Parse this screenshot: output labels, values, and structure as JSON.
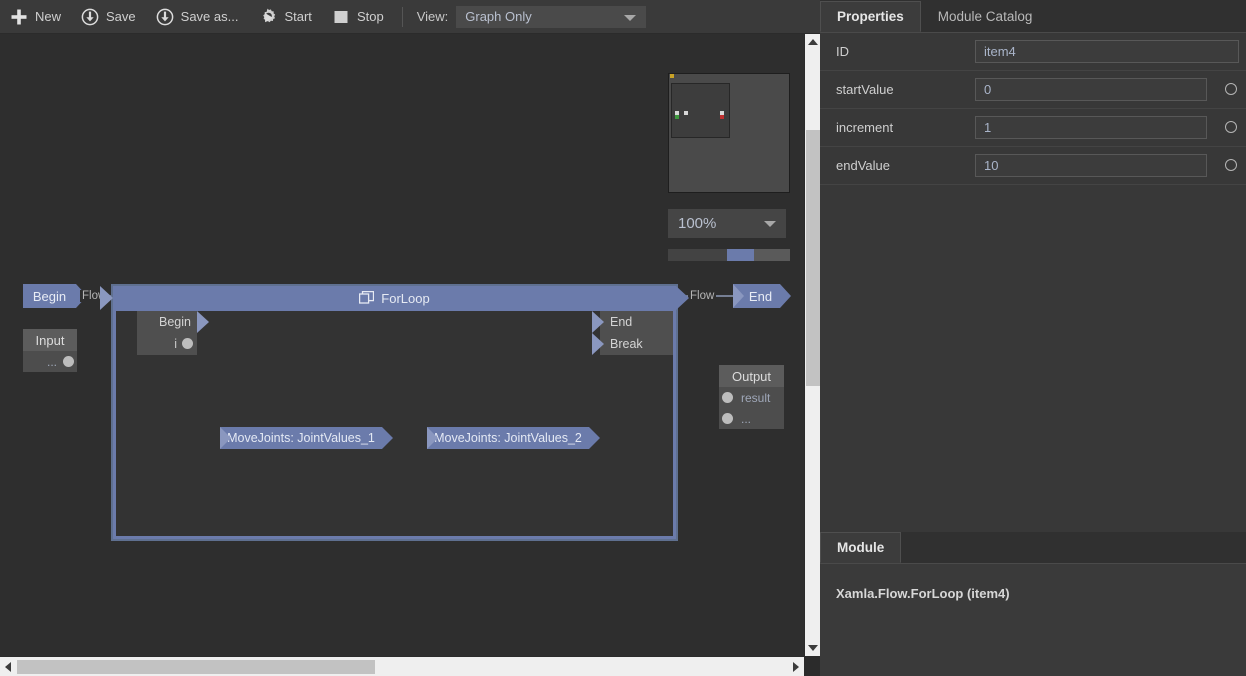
{
  "toolbar": {
    "buttons": [
      {
        "label": "New",
        "icon": "plus-icon"
      },
      {
        "label": "Save",
        "icon": "save-download-icon"
      },
      {
        "label": "Save as...",
        "icon": "save-as-download-icon"
      },
      {
        "label": "Start",
        "icon": "gear-play-icon"
      },
      {
        "label": "Stop",
        "icon": "stop-square-icon"
      }
    ],
    "view_label": "View:",
    "view_value": "Graph Only"
  },
  "canvas": {
    "begin_node": {
      "label": "Begin"
    },
    "flow_label_left": "Flow",
    "flow_label_right": "Flow",
    "end_node": {
      "label": "End"
    },
    "input_node": {
      "title": "Input",
      "rows": [
        "..."
      ]
    },
    "output_node": {
      "title": "Output",
      "rows": [
        "result",
        "..."
      ]
    },
    "forloop": {
      "title": "ForLoop",
      "icon": "window-frame-icon",
      "begin_panel": {
        "title": "Begin",
        "rows": [
          "i"
        ]
      },
      "end_panel": {
        "rows": [
          "End",
          "Break"
        ]
      },
      "steps": [
        "MoveJoints: JointValues_1",
        "MoveJoints: JointValues_2"
      ]
    }
  },
  "minimap": {
    "markers": [
      {
        "color": "#c9a227",
        "x": 1,
        "y": 0
      },
      {
        "color": "#d8d8d8",
        "x": 8,
        "y": 38
      },
      {
        "color": "#3f9a3f",
        "x": 8,
        "y": 42
      },
      {
        "color": "#d8d8d8",
        "x": 17,
        "y": 38
      },
      {
        "color": "#d8d8d8",
        "x": 53,
        "y": 38
      },
      {
        "color": "#c03030",
        "x": 53,
        "y": 42
      }
    ]
  },
  "zoom": {
    "value": "100%",
    "slider_percent": 48
  },
  "panel": {
    "tabs": [
      {
        "label": "Properties",
        "active": true
      },
      {
        "label": "Module Catalog",
        "active": false
      }
    ],
    "properties": [
      {
        "name": "ID",
        "value": "item4",
        "has_circle": false
      },
      {
        "name": "startValue",
        "value": "0",
        "has_circle": true
      },
      {
        "name": "increment",
        "value": "1",
        "has_circle": true
      },
      {
        "name": "endValue",
        "value": "10",
        "has_circle": true
      }
    ],
    "module": {
      "tab_label": "Module",
      "text": "Xamla.Flow.ForLoop (item4)"
    }
  },
  "colors": {
    "accent_blue": "#6b7bab",
    "accent_light": "#8a97bf",
    "toolbar_bg": "#3a3a3a",
    "canvas_bg": "#2e2e2e",
    "panel_bg": "#383838"
  }
}
